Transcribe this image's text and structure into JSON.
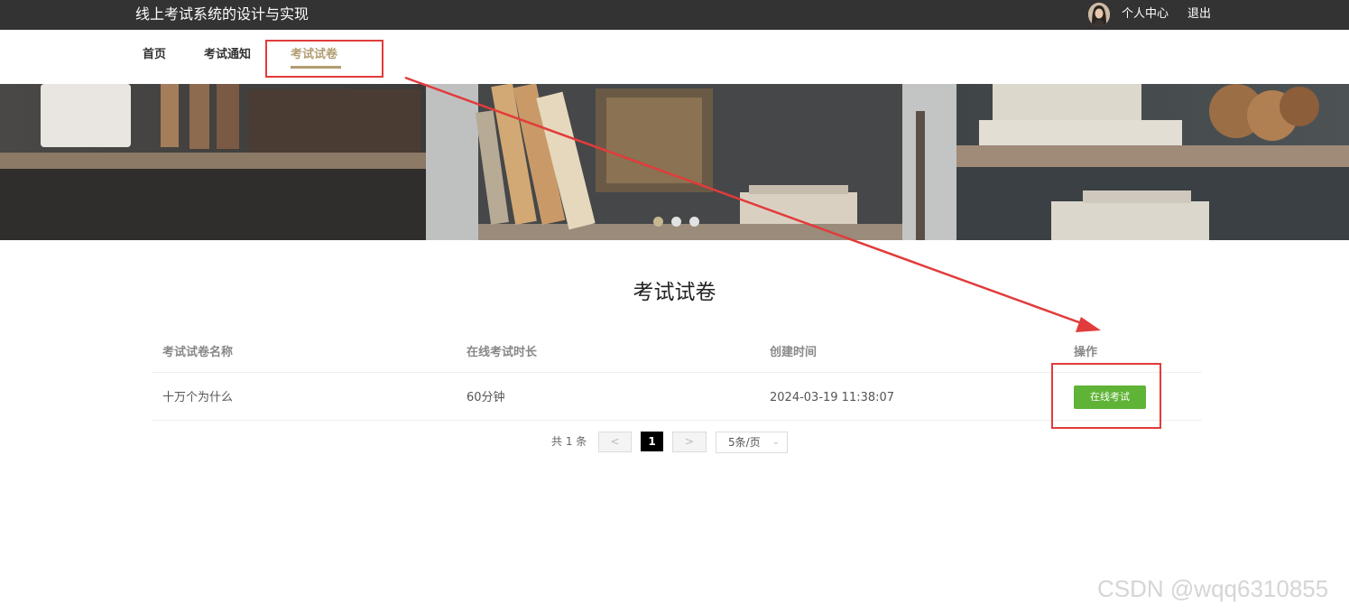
{
  "header": {
    "site_title": "线上考试系统的设计与实现",
    "user_center": "个人中心",
    "logout": "退出"
  },
  "nav": {
    "items": [
      {
        "label": "首页",
        "active": false
      },
      {
        "label": "考试通知",
        "active": false
      },
      {
        "label": "考试试卷",
        "active": true
      }
    ]
  },
  "banner": {
    "slide_count": 3,
    "active_slide": 1
  },
  "main": {
    "title": "考试试卷",
    "table": {
      "columns": [
        "考试试卷名称",
        "在线考试时长",
        "创建时间",
        "操作"
      ],
      "rows": [
        {
          "name": "十万个为什么",
          "duration": "60分钟",
          "created": "2024-03-19 11:38:07",
          "action": "在线考试"
        }
      ]
    },
    "pagination": {
      "total": "共 1 条",
      "prev": "<",
      "current": "1",
      "next": ">",
      "page_size": "5条/页"
    }
  },
  "colors": {
    "accent": "#b19d72",
    "topbar": "#333333",
    "button_green": "#5fb336",
    "annotation_red": "#e23b3b"
  },
  "watermark": "CSDN @wqq6310855"
}
